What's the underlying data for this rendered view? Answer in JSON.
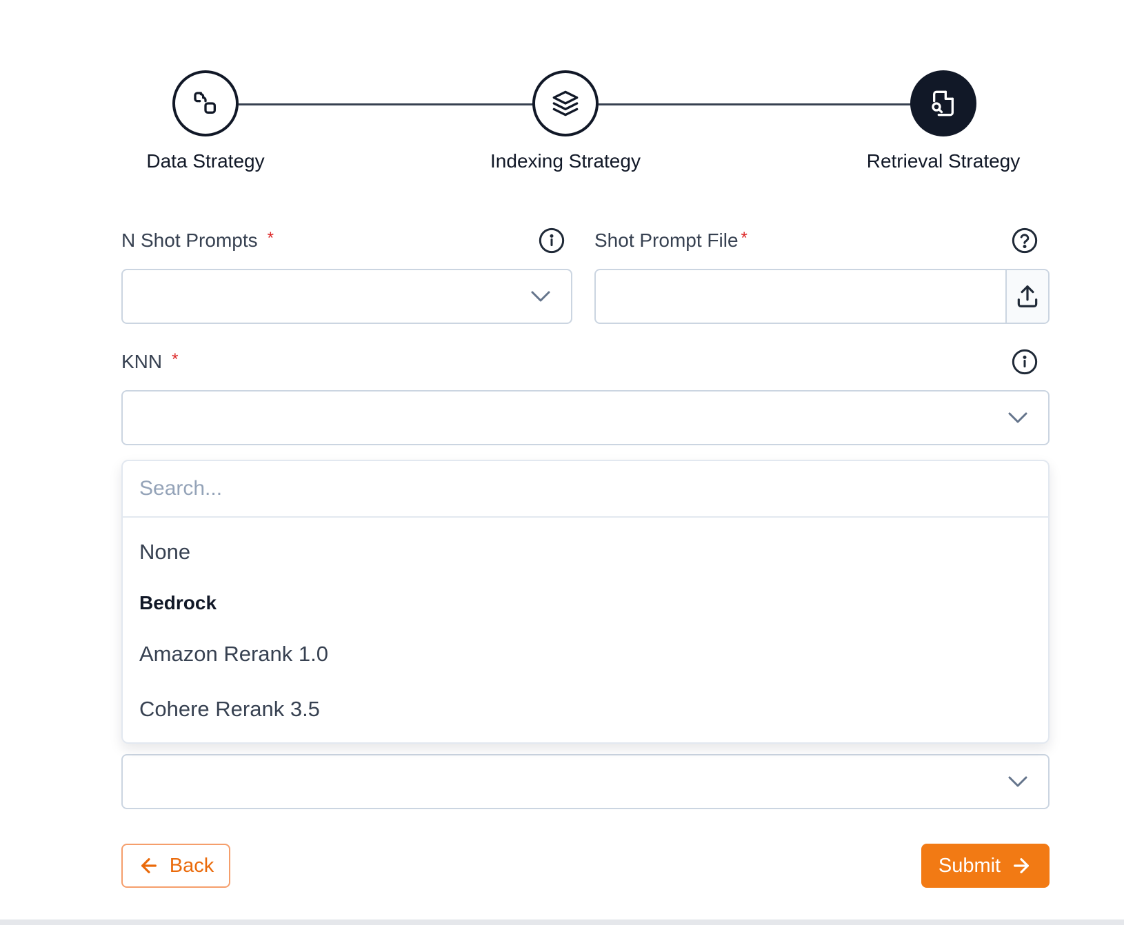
{
  "stepper": {
    "steps": [
      {
        "label": "Data Strategy",
        "icon": "shapes-icon",
        "state": "completed"
      },
      {
        "label": "Indexing Strategy",
        "icon": "layers-icon",
        "state": "completed"
      },
      {
        "label": "Retrieval Strategy",
        "icon": "file-search-icon",
        "state": "active"
      }
    ]
  },
  "form": {
    "n_shot": {
      "label": "N Shot Prompts",
      "required": "*",
      "value": ""
    },
    "shot_file": {
      "label": "Shot Prompt File",
      "required": "*",
      "value": ""
    },
    "knn": {
      "label": "KNN",
      "required": "*",
      "value": ""
    },
    "reranker": {
      "value": ""
    }
  },
  "dropdown": {
    "search_placeholder": "Search...",
    "option_none": "None",
    "group_label": "Bedrock",
    "options": [
      "Amazon Rerank 1.0",
      "Cohere Rerank 3.5"
    ]
  },
  "actions": {
    "back_label": "Back",
    "submit_label": "Submit"
  },
  "colors": {
    "accent": "#f27a14",
    "dark": "#111827",
    "required": "#dc2626",
    "border": "#cbd5e1"
  }
}
